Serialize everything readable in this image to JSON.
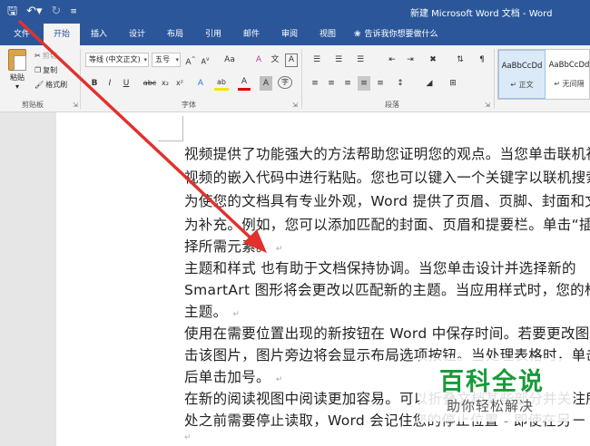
{
  "window": {
    "title": "新建 Microsoft Word 文档 - Word"
  },
  "qat": {
    "save_icon": "save-icon",
    "undo_icon": "undo-icon",
    "redo_icon": "redo-icon"
  },
  "tabs": [
    {
      "label": "文件"
    },
    {
      "label": "开始"
    },
    {
      "label": "插入"
    },
    {
      "label": "设计"
    },
    {
      "label": "布局"
    },
    {
      "label": "引用"
    },
    {
      "label": "邮件"
    },
    {
      "label": "审阅"
    },
    {
      "label": "视图"
    }
  ],
  "tellme": {
    "text": "告诉我你想要做什么"
  },
  "clipboard": {
    "paste": "粘贴",
    "cut": "剪切",
    "copy": "复制",
    "format_painter": "格式刷",
    "group": "剪贴板"
  },
  "font": {
    "name": "等线 (中文正文)",
    "size": "五号",
    "grow": "A",
    "shrink": "A",
    "case": "Aa",
    "clear": "A",
    "wen": "文",
    "box_a": "A",
    "bold": "B",
    "italic": "I",
    "underline": "U",
    "strike": "abc",
    "sub": "x₂",
    "sup": "x²",
    "effects": "A",
    "highlight": "ab",
    "color": "A",
    "shade": "A",
    "circle": "字",
    "group": "字体"
  },
  "paragraph": {
    "group": "段落"
  },
  "styles": [
    {
      "sample": "AaBbCcDd",
      "name": "正文"
    },
    {
      "sample": "AaBbCcDd",
      "name": "无间隔"
    }
  ],
  "document": {
    "lines": [
      "视频提供了功能强大的方法帮助您证明您的观点。当您单击联机视频",
      "视频的嵌入代码中进行粘贴。您也可以键入一个关键字以联机搜索",
      "为使您的文档具有专业外观，Word 提供了页眉、页脚、封面和文本",
      "为补充。例如，您可以添加匹配的封面、页眉和提要栏。单击“插入”",
      "择所需元素。",
      "主题和样式      也有助于文档保持协调。当您单击设计并选择新的",
      "SmartArt 图形将会更改以匹配新的主题。当应用样式时，您的标题",
      "主题。",
      "使用在需要位置出现的新按钮在 Word 中保存时间。若要更改图片",
      "击该图片，图片旁边将会显示布局选项按钮。当处理表格时，单击",
      "后单击加号。",
      "在新的阅读视图中阅读更加容易。可以折叠文档某些部分并关注所",
      "处之前需要停止读取，Word 会记住您的停止位置 - 即使在另一"
    ]
  },
  "watermark": {
    "title": "百科全说",
    "subtitle": "助你轻松解决"
  },
  "colors": {
    "brand": "#2b579a",
    "arrow": "#e0322d",
    "watermark_green": "#1a9a3a"
  }
}
